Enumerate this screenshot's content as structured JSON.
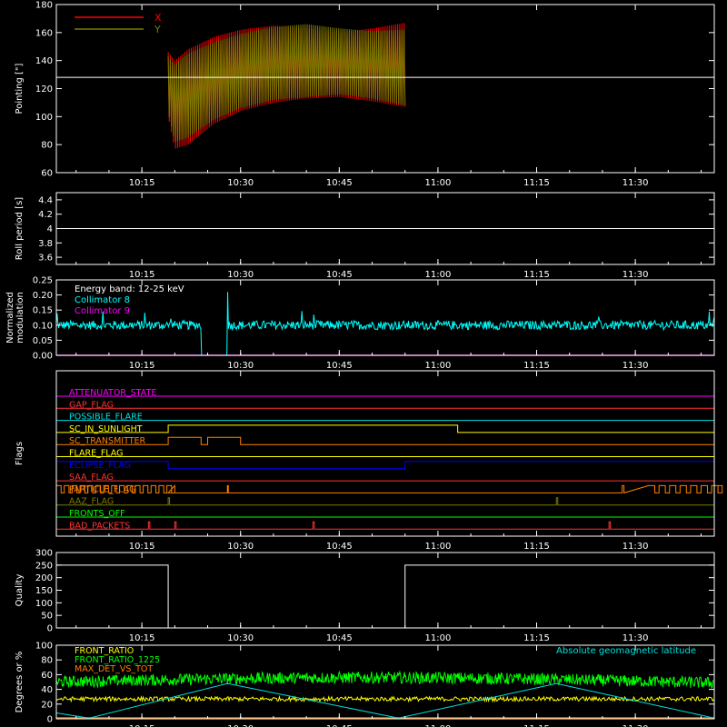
{
  "chart_data": [
    {
      "type": "line",
      "ylabel": "Pointing [\"]",
      "ylim": [
        60,
        180
      ],
      "yticks": [
        60,
        80,
        100,
        120,
        140,
        160,
        180
      ],
      "xlim": [
        "10:02",
        "11:42"
      ],
      "xticks": [
        "10:15",
        "10:30",
        "10:45",
        "11:00",
        "11:15",
        "11:30"
      ],
      "reference_line": 128,
      "legend": [
        {
          "name": "X",
          "color": "#ff0000"
        },
        {
          "name": "Y",
          "color": "#7a7a00"
        }
      ],
      "series": [
        {
          "name": "X",
          "color": "#ff0000",
          "x": [
            "10:19",
            "10:20",
            "10:22",
            "10:26",
            "10:30",
            "10:35",
            "10:40",
            "10:45",
            "10:50",
            "10:55"
          ],
          "upper": [
            146,
            140,
            148,
            157,
            162,
            165,
            163,
            160,
            163,
            167
          ],
          "lower": [
            100,
            77,
            80,
            95,
            104,
            110,
            113,
            114,
            111,
            107
          ]
        },
        {
          "name": "Y",
          "color": "#7a7a00",
          "x": [
            "10:19",
            "10:20",
            "10:22",
            "10:26",
            "10:30",
            "10:35",
            "10:40",
            "10:45",
            "10:50",
            "10:55"
          ],
          "upper": [
            143,
            137,
            145,
            153,
            159,
            164,
            166,
            163,
            161,
            162
          ],
          "lower": [
            103,
            82,
            85,
            98,
            106,
            112,
            114,
            116,
            113,
            108
          ]
        }
      ]
    },
    {
      "type": "line",
      "ylabel": "Roll period [s]",
      "ylim": [
        3.5,
        4.5
      ],
      "yticks": [
        3.6,
        3.8,
        4.0,
        4.2,
        4.4
      ],
      "xticks": [
        "10:15",
        "10:30",
        "10:45",
        "11:00",
        "11:15",
        "11:30"
      ],
      "series": [
        {
          "name": "",
          "color": "#ffffff",
          "x": [
            "10:02",
            "11:42"
          ],
          "y": [
            4.0,
            4.0
          ]
        }
      ]
    },
    {
      "type": "line",
      "ylabel": "Normalized modulation",
      "ylim": [
        0,
        0.25
      ],
      "yticks": [
        0.0,
        0.05,
        0.1,
        0.15,
        0.2,
        0.25
      ],
      "yticklabels": [
        "0.00",
        "0.05",
        "0.10",
        "0.15",
        "0.20",
        "0.25"
      ],
      "xticks": [
        "10:15",
        "10:30",
        "10:45",
        "11:00",
        "11:15",
        "11:30"
      ],
      "annotations": [
        "Energy band: 12-25 keV"
      ],
      "series": [
        {
          "name": "Collimator 8",
          "color": "#00ffff",
          "baseline": 0.1,
          "noise": 0.015,
          "gaps": [
            [
              "10:24",
              "10:28"
            ]
          ],
          "spikes": [
            {
              "x": "10:28",
              "y": 0.21
            }
          ]
        },
        {
          "name": "Collimator 9",
          "color": "#ff00ff",
          "constant": 0.0
        }
      ]
    },
    {
      "type": "line",
      "ylabel": "Flags",
      "xticks": [
        "10:15",
        "10:30",
        "10:45",
        "11:00",
        "11:15",
        "11:30"
      ],
      "series": [
        {
          "name": "ATTENUATOR_STATE",
          "color": "#ff00ff",
          "on_intervals": []
        },
        {
          "name": "GAP_FLAG",
          "color": "#ff3333",
          "on_intervals": []
        },
        {
          "name": "POSSIBLE_FLARE",
          "color": "#00e0e0",
          "on_intervals": []
        },
        {
          "name": "SC_IN_SUNLIGHT",
          "color": "#ffff00",
          "on_intervals": [
            [
              "10:19",
              "11:03"
            ]
          ]
        },
        {
          "name": "SC_TRANSMITTER",
          "color": "#ff8000",
          "on_intervals": [
            [
              "10:19",
              "10:24"
            ],
            [
              "10:25",
              "10:30"
            ]
          ]
        },
        {
          "name": "FLARE_FLAG",
          "color": "#ffff00",
          "on_intervals": []
        },
        {
          "name": "ECLIPSE_FLAG",
          "color": "#0000ff",
          "on_intervals": [
            [
              "10:02",
              "10:19"
            ],
            [
              "10:55",
              "11:42"
            ]
          ]
        },
        {
          "name": "SAA_FLAG",
          "color": "#ff3333",
          "on_intervals": []
        },
        {
          "name": "PARTICLE_FLAG",
          "color": "#ff8000",
          "on_intervals": [
            [
              "10:02",
              "10:19"
            ],
            [
              "10:28",
              "10:29"
            ],
            [
              "11:32",
              "11:42"
            ]
          ]
        },
        {
          "name": "AAZ_FLAG",
          "color": "#7a7a00",
          "on_intervals": [
            [
              "10:19",
              "10:19"
            ],
            [
              "11:18",
              "11:18"
            ]
          ]
        },
        {
          "name": "FRONTS_OFF",
          "color": "#00ff00",
          "on_intervals": []
        },
        {
          "name": "BAD_PACKETS",
          "color": "#ff3333",
          "on_intervals": [
            [
              "10:16",
              "10:16"
            ],
            [
              "10:20",
              "10:20"
            ],
            [
              "10:41",
              "10:41"
            ],
            [
              "11:26",
              "11:26"
            ]
          ]
        }
      ]
    },
    {
      "type": "line",
      "ylabel": "Quality",
      "ylim": [
        0,
        300
      ],
      "yticks": [
        0,
        50,
        100,
        150,
        200,
        250,
        300
      ],
      "xticks": [
        "10:15",
        "10:30",
        "10:45",
        "11:00",
        "11:15",
        "11:30"
      ],
      "series": [
        {
          "name": "",
          "color": "#ffffff",
          "x": [
            "10:02",
            "10:19",
            "10:19",
            "10:55",
            "10:55",
            "11:42"
          ],
          "y": [
            250,
            250,
            0,
            0,
            250,
            250
          ]
        }
      ]
    },
    {
      "type": "line",
      "ylabel": "Degrees or %",
      "ylim": [
        0,
        100
      ],
      "yticks": [
        0,
        20,
        40,
        60,
        80,
        100
      ],
      "xticks": [
        "10:15",
        "10:30",
        "10:45",
        "11:00",
        "11:15",
        "11:30"
      ],
      "annotations": [
        "Absolute geomagnetic latitude"
      ],
      "series": [
        {
          "name": "FRONT_RATIO",
          "color": "#ffff00",
          "baseline": 27,
          "noise": 3
        },
        {
          "name": "FRONT_RATIO_1225",
          "color": "#00ff00",
          "baseline": 50,
          "noise": 8
        },
        {
          "name": "MAX_DET_VS_TOT",
          "color": "#ff8000",
          "constant": 0
        },
        {
          "name": "Absolute geomagnetic latitude",
          "color": "#00e0e0",
          "x": [
            "10:02",
            "10:07",
            "10:28",
            "10:54",
            "11:18",
            "11:42"
          ],
          "y": [
            8,
            1,
            48,
            1,
            48,
            1
          ]
        }
      ]
    }
  ]
}
